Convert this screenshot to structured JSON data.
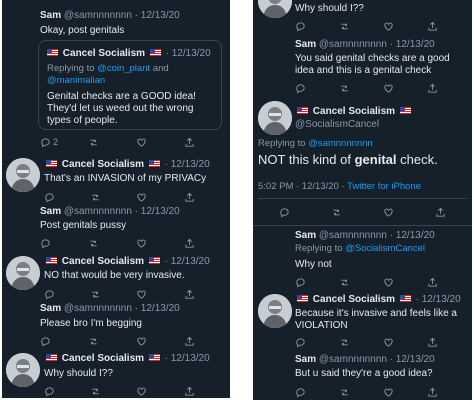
{
  "left": {
    "tweets": [
      {
        "name": "Sam",
        "handle": "@samnnnnnnn",
        "date": "12/13/20",
        "text": "Okay, post genitals"
      },
      {
        "quote": {
          "name": "Cancel Socialism",
          "date": "12/13/20",
          "replying_prefix": "Replying to",
          "mention1": "@coin_plant",
          "and": "and",
          "mention2": "@manimalian",
          "text": "Genital checks are a GOOD idea! They'd let us weed out the wrong types of people."
        },
        "reply_count": "2"
      },
      {
        "name": "Cancel Socialism",
        "date": "12/13/20",
        "text": "That's an INVASION of my PRIVACy"
      },
      {
        "name": "Sam",
        "handle": "@samnnnnnnn",
        "date": "12/13/20",
        "text": "Post genitals pussy"
      },
      {
        "name": "Cancel Socialism",
        "date": "12/13/20",
        "text": "NO that would be very invasive."
      },
      {
        "name": "Sam",
        "handle": "@samnnnnnnn",
        "date": "12/13/20",
        "text": "Please bro I'm begging"
      },
      {
        "name": "Cancel Socialism",
        "date": "12/13/20",
        "text": "Why should I??"
      }
    ]
  },
  "right": {
    "top_text": "Why should I??",
    "sam1": {
      "name": "Sam",
      "handle": "@samnnnnnnn",
      "date": "12/13/20",
      "text": "You said genital checks are a good idea and this is a genital check"
    },
    "main": {
      "name": "Cancel Socialism",
      "handle": "@SocialismCancel",
      "replying_prefix": "Replying to",
      "mention": "@samnnnnnnn",
      "text_pre": "NOT this kind of",
      "text_bold": "genital",
      "text_post": "check.",
      "time": "5:02 PM · 12/13/20 · ",
      "client": "Twitter for iPhone"
    },
    "sam2": {
      "name": "Sam",
      "handle": "@samnnnnnnn",
      "date": "12/13/20",
      "replying_prefix": "Replying to",
      "mention": "@SocialismCancel",
      "text": "Why not"
    },
    "cs2": {
      "name": "Cancel Socialism",
      "date": "12/13/20",
      "text": "Because it's invasive and feels like a VIOLATION"
    },
    "sam3": {
      "name": "Sam",
      "handle": "@samnnnnnnn",
      "date": "12/13/20",
      "text": "But u said they're a good idea?"
    }
  },
  "colors": {
    "background": "#15202b",
    "text": "#e7e9ea",
    "muted": "#8b98a5",
    "link": "#1d9bf0",
    "border": "#38444d"
  },
  "icons": [
    "reply-icon",
    "retweet-icon",
    "like-icon",
    "share-icon",
    "us-flag-icon",
    "avatar-portrait"
  ]
}
